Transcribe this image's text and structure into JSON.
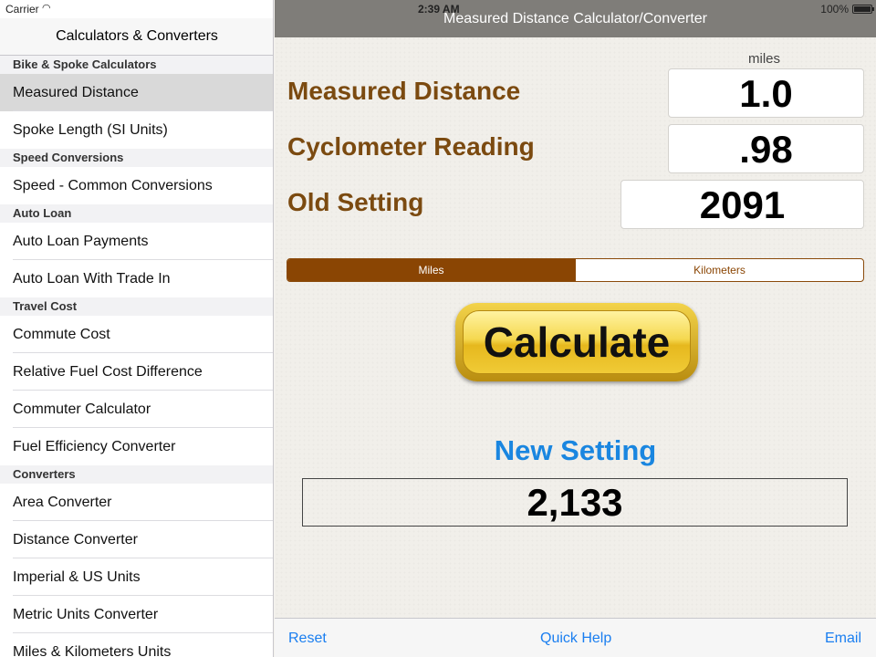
{
  "status_bar": {
    "carrier": "Carrier",
    "time": "2:39 AM",
    "battery": "100%"
  },
  "sidebar": {
    "title": "Calculators & Converters",
    "sections": [
      {
        "header": "Bike & Spoke Calculators",
        "items": [
          "Measured Distance",
          "Spoke Length (SI Units)"
        ]
      },
      {
        "header": "Speed Conversions",
        "items": [
          "Speed - Common Conversions"
        ]
      },
      {
        "header": "Auto Loan",
        "items": [
          "Auto Loan Payments",
          "Auto Loan With Trade In"
        ]
      },
      {
        "header": "Travel Cost",
        "items": [
          "Commute Cost",
          "Relative Fuel Cost Difference",
          "Commuter Calculator",
          "Fuel Efficiency Converter"
        ]
      },
      {
        "header": "Converters",
        "items": [
          "Area Converter",
          "Distance Converter",
          "Imperial & US Units",
          "Metric Units Converter",
          "Miles & Kilometers Units"
        ]
      }
    ],
    "selected": "Measured Distance"
  },
  "main": {
    "title": "Measured Distance Calculator/Converter",
    "unit_label": "miles",
    "fields": {
      "measured_distance": {
        "label": "Measured Distance",
        "value": "1.0"
      },
      "cyclometer_reading": {
        "label": "Cyclometer Reading",
        "value": ".98"
      },
      "old_setting": {
        "label": "Old Setting",
        "value": "2091"
      }
    },
    "segments": {
      "miles": "Miles",
      "kilometers": "Kilometers",
      "selected": "Miles"
    },
    "calculate_label": "Calculate",
    "result_label": "New Setting",
    "result_value": "2,133"
  },
  "toolbar": {
    "reset": "Reset",
    "quick_help": "Quick Help",
    "email": "Email"
  },
  "colors": {
    "label_brown": "#7b4a10",
    "segment_brown": "#8a4503",
    "result_blue": "#1a86e0",
    "link_blue": "#1a7ef0"
  }
}
